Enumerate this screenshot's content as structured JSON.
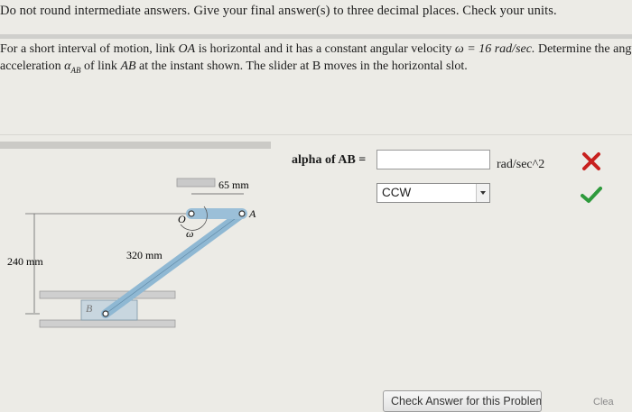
{
  "instructions": "Do not round intermediate answers.  Give your final answer(s) to three decimal places.  Check your units.",
  "problem": {
    "line1_a": "For a short interval of motion, link ",
    "line1_oa": "OA",
    "line1_b": " is horizontal and it has a constant angular velocity ",
    "line1_omega": "ω = 16 rad/sec.",
    "line1_c": "  Determine the angular",
    "line2_a": "acceleration ",
    "line2_alpha": "α",
    "line2_sub": "AB",
    "line2_b": " of link ",
    "line2_ab": "AB",
    "line2_c": " at the instant shown.  The slider at B moves in the horizontal slot."
  },
  "diagram": {
    "dim_oa": "65 mm",
    "dim_ab_horizontal": "320 mm",
    "dim_vertical": "240 mm",
    "label_o": "O",
    "label_a": "A",
    "label_b": "B",
    "label_omega": "ω"
  },
  "answer": {
    "alpha_label": "alpha of AB =",
    "alpha_value": "",
    "unit": "rad/sec^2",
    "direction_selected": "CCW",
    "status_colors": {
      "incorrect": "#c8201e",
      "correct": "#2e9a3c"
    }
  },
  "buttons": {
    "check_answer": "Check Answer for this Problem",
    "clear": "Clea"
  }
}
